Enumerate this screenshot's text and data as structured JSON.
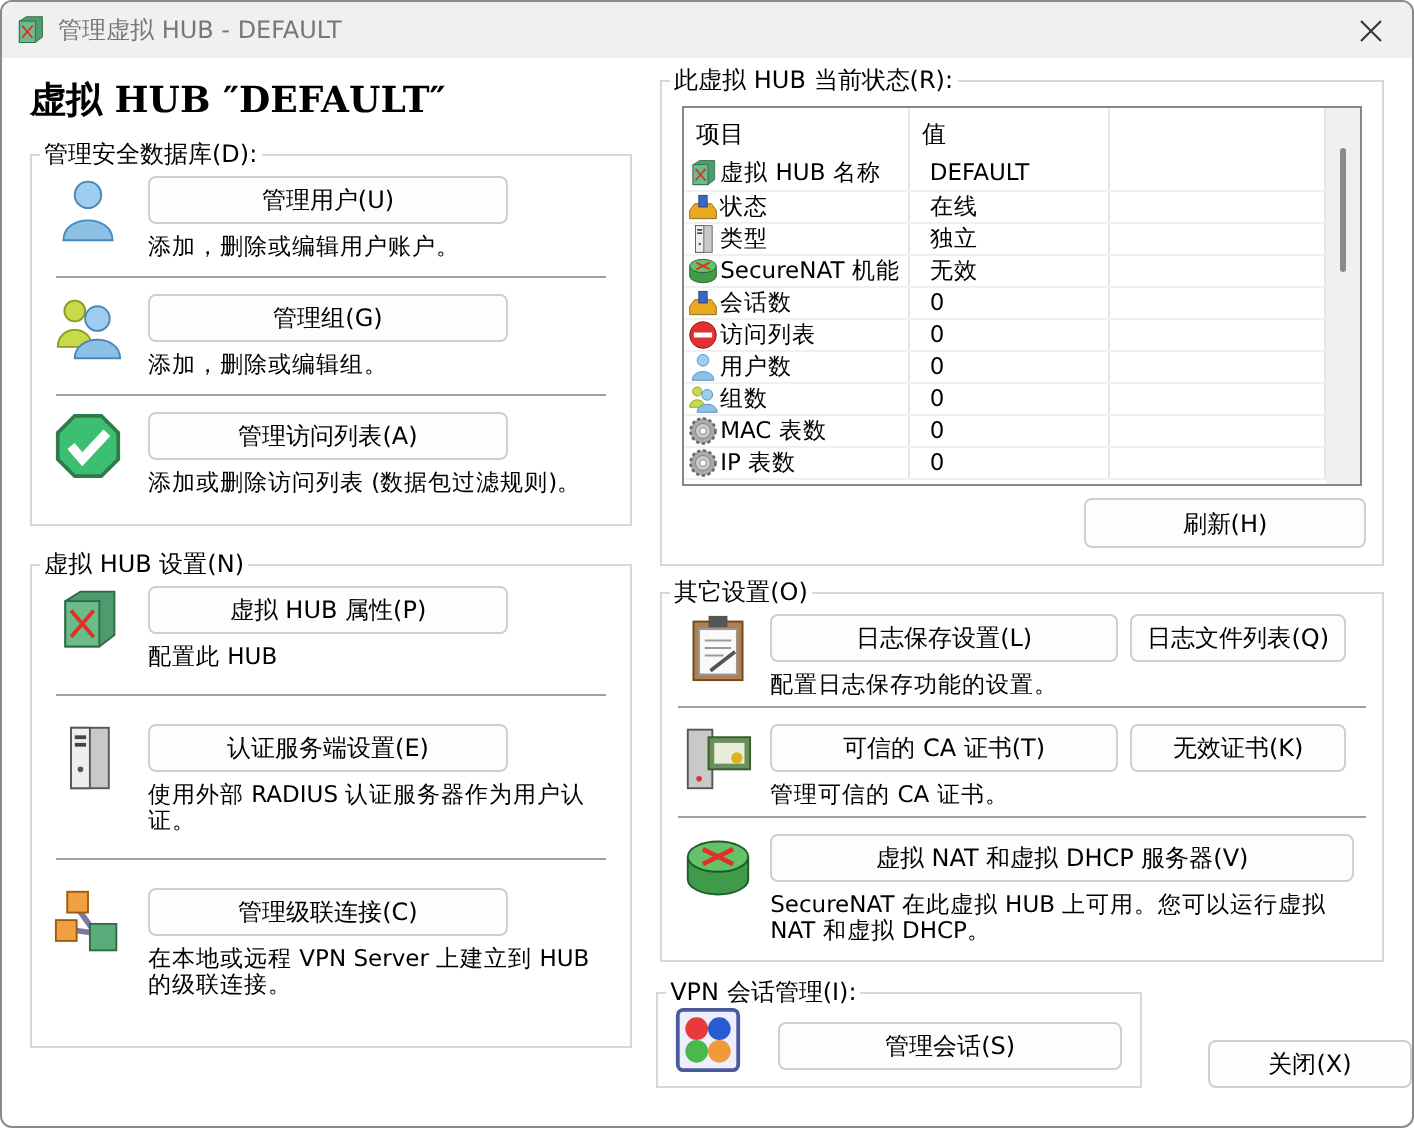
{
  "window": {
    "title": "管理虚拟 HUB - DEFAULT"
  },
  "heading": "虚拟 HUB ″DEFAULT″",
  "security_group": {
    "title": "管理安全数据库(D):",
    "items": [
      {
        "kind": "user",
        "button": "管理用户(U)",
        "description": "添加，删除或编辑用户账户。"
      },
      {
        "kind": "group",
        "button": "管理组(G)",
        "description": "添加，删除或编辑组。"
      },
      {
        "kind": "check",
        "button": "管理访问列表(A)",
        "description": "添加或删除访问列表 (数据包过滤规则)。"
      }
    ]
  },
  "hub_settings": {
    "title": "虚拟 HUB 设置(N)",
    "items": [
      {
        "kind": "hub",
        "button": "虚拟 HUB 属性(P)",
        "description": "配置此 HUB"
      },
      {
        "kind": "server",
        "button": "认证服务端设置(E)",
        "description": "使用外部 RADIUS 认证服务器作为用户认证。"
      },
      {
        "kind": "cascade",
        "button": "管理级联连接(C)",
        "description": "在本地或远程 VPN Server 上建立到 HUB 的级联连接。"
      }
    ]
  },
  "status": {
    "title": "此虚拟 HUB 当前状态(R):",
    "columns": [
      "项目",
      "值"
    ],
    "rows": [
      {
        "kind": "hub",
        "item": "虚拟 HUB 名称",
        "value": "DEFAULT"
      },
      {
        "kind": "tray",
        "item": "状态",
        "value": "在线"
      },
      {
        "kind": "server",
        "item": "类型",
        "value": "独立"
      },
      {
        "kind": "router",
        "item": "SecureNAT 机能",
        "value": "无效"
      },
      {
        "kind": "tray",
        "item": "会话数",
        "value": "0"
      },
      {
        "kind": "stop",
        "item": "访问列表",
        "value": "0"
      },
      {
        "kind": "user",
        "item": "用户数",
        "value": "0"
      },
      {
        "kind": "group",
        "item": "组数",
        "value": "0"
      },
      {
        "kind": "gear",
        "item": "MAC 表数",
        "value": "0"
      },
      {
        "kind": "gear",
        "item": "IP 表数",
        "value": "0"
      }
    ],
    "refresh_button": "刷新(H)"
  },
  "other_settings": {
    "title": "其它设置(O)",
    "items": [
      {
        "kind": "clipboard",
        "buttons": [
          "日志保存设置(L)",
          "日志文件列表(Q)"
        ],
        "description": "配置日志保存功能的设置。"
      },
      {
        "kind": "certificate",
        "buttons": [
          "可信的 CA 证书(T)",
          "无效证书(K)"
        ],
        "description": "管理可信的 CA 证书。"
      },
      {
        "kind": "router",
        "buttons": [
          "虚拟 NAT 和虚拟 DHCP 服务器(V)"
        ],
        "description": "SecureNAT 在此虚拟 HUB 上可用。您可以运行虚拟 NAT 和虚拟 DHCP。"
      }
    ]
  },
  "session_group": {
    "title": "VPN 会话管理(I):",
    "kind": "session",
    "button": "管理会话(S)"
  },
  "close_button": "关闭(X)"
}
